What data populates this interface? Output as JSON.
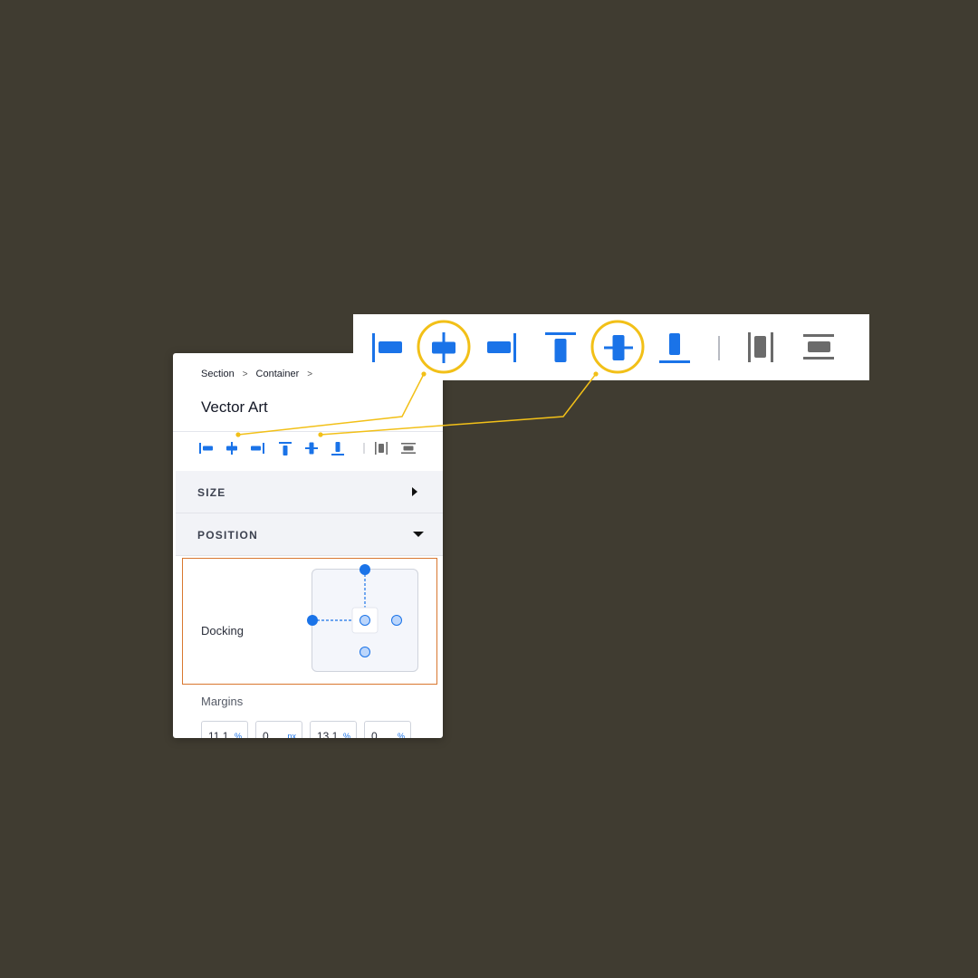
{
  "breadcrumb": {
    "items": [
      "Section",
      "Container"
    ],
    "separator": ">"
  },
  "panel": {
    "title": "Vector Art",
    "sections": {
      "size": {
        "label": "SIZE",
        "state": "collapsed"
      },
      "position": {
        "label": "POSITION",
        "state": "expanded"
      }
    },
    "docking": {
      "label": "Docking",
      "docked_sides": [
        "top",
        "left"
      ]
    },
    "margins": {
      "label": "Margins",
      "fields": [
        {
          "value": "11.1",
          "unit": "%"
        },
        {
          "value": "0",
          "unit": "px"
        },
        {
          "value": "13.1",
          "unit": "%"
        },
        {
          "value": "0",
          "unit": "%"
        }
      ]
    }
  },
  "alignment_tools": [
    {
      "name": "align-left-icon"
    },
    {
      "name": "align-horizontal-center-icon",
      "highlighted": true
    },
    {
      "name": "align-right-icon"
    },
    {
      "name": "align-top-icon"
    },
    {
      "name": "align-vertical-center-icon",
      "highlighted": true
    },
    {
      "name": "align-bottom-icon"
    },
    {
      "name": "distribute-horizontal-icon"
    },
    {
      "name": "distribute-vertical-icon"
    }
  ],
  "colors": {
    "background": "#403c31",
    "accent_blue": "#1a73e8",
    "highlight_yellow": "#f2c018",
    "docking_outline": "#d9772f",
    "distribute_gray": "#6b6b6b"
  }
}
